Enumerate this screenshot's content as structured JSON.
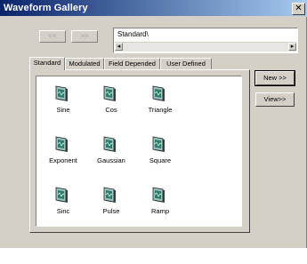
{
  "window": {
    "title": "Waveform Gallery",
    "close_glyph": "✕"
  },
  "nav": {
    "back_label": "<<",
    "forward_label": ">>"
  },
  "path": {
    "text": "Standard\\",
    "scroll_left": "◂",
    "scroll_right": "▸"
  },
  "tabs": [
    {
      "label": "Standard",
      "active": true
    },
    {
      "label": "Modulated"
    },
    {
      "label": "Field Depended"
    },
    {
      "label": "User Defined"
    }
  ],
  "items": [
    {
      "label": "Sine",
      "icon": "waveform-icon"
    },
    {
      "label": "Cos",
      "icon": "waveform-icon"
    },
    {
      "label": "Triangle",
      "icon": "waveform-icon"
    },
    {
      "label": "Exponent",
      "icon": "waveform-icon"
    },
    {
      "label": "Gaussian",
      "icon": "waveform-icon"
    },
    {
      "label": "Square",
      "icon": "waveform-icon"
    },
    {
      "label": "Sinc",
      "icon": "waveform-icon"
    },
    {
      "label": "Pulse",
      "icon": "waveform-icon"
    },
    {
      "label": "Ramp",
      "icon": "waveform-icon"
    }
  ],
  "buttons": {
    "new_label": "New >>",
    "view_label": "View>>"
  },
  "colors": {
    "titlebar_start": "#0a246a",
    "titlebar_end": "#a6caf0",
    "face": "#d4d0c8"
  }
}
